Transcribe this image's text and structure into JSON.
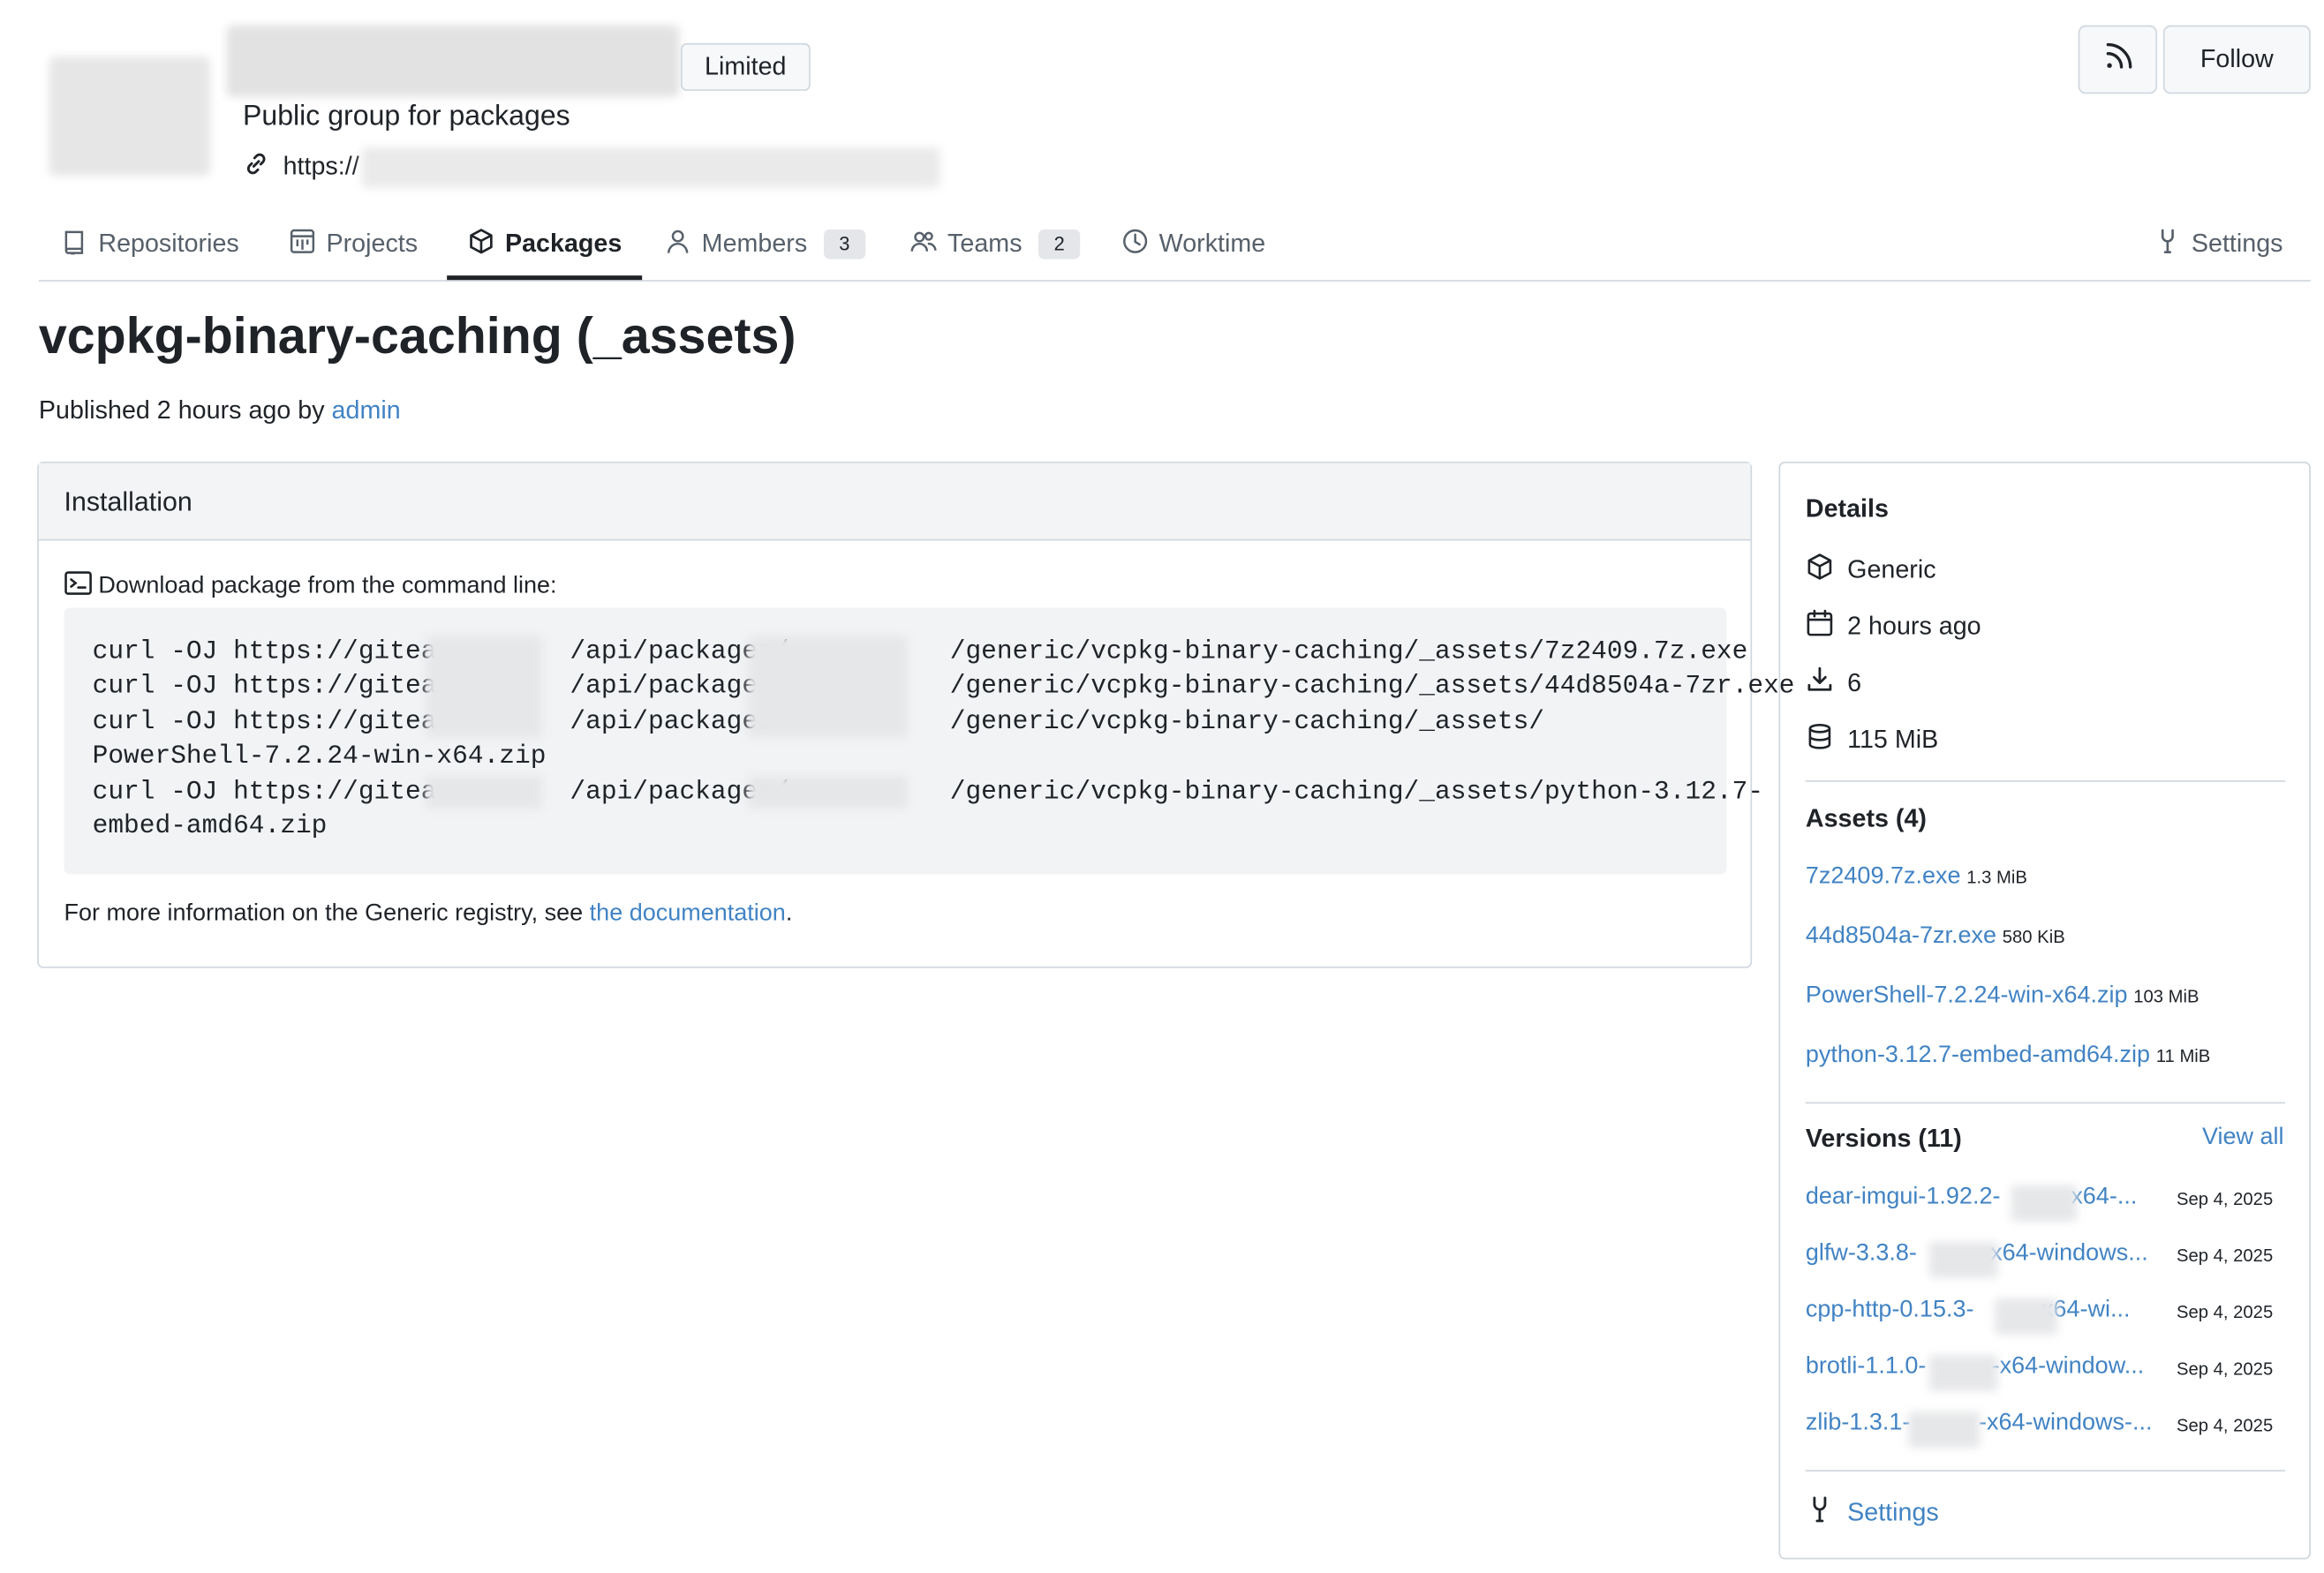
{
  "org": {
    "badge": "Limited",
    "description": "Public group for packages",
    "url_prefix": "https://",
    "follow_label": "Follow"
  },
  "tabs": [
    {
      "label": "Repositories"
    },
    {
      "label": "Projects"
    },
    {
      "label": "Packages"
    },
    {
      "label": "Members",
      "count": "3"
    },
    {
      "label": "Teams",
      "count": "2"
    },
    {
      "label": "Worktime"
    }
  ],
  "settings_tab": "Settings",
  "package": {
    "title": "vcpkg-binary-caching (_assets)",
    "published_prefix": "Published 2 hours ago by ",
    "publisher": "admin"
  },
  "installation": {
    "heading": "Installation",
    "subtitle": "Download package from the command line:",
    "code_lines": [
      {
        "a": "curl -OJ https://gitea.",
        "b": "/api/packages/",
        "c": "/generic/vcpkg-binary-caching/_assets/7z2409.7z.exe"
      },
      {
        "a": "curl -OJ https://gitea.",
        "b": "/api/packages/",
        "c": "/generic/vcpkg-binary-caching/_assets/44d8504a-7zr.exe"
      },
      {
        "a": "curl -OJ https://gitea.",
        "b": "/api/packages/",
        "c": "/generic/vcpkg-binary-caching/_assets/"
      },
      {
        "a": "PowerShell-7.2.24-win-x64.zip"
      },
      {
        "a": "curl -OJ https://gitea.",
        "b": "/api/packages/",
        "c": "/generic/vcpkg-binary-caching/_assets/python-3.12.7-"
      },
      {
        "a": "embed-amd64.zip"
      }
    ],
    "footer_prefix": "For more information on the Generic registry, see ",
    "footer_link": "the documentation",
    "footer_suffix": "."
  },
  "details": {
    "heading": "Details",
    "type": "Generic",
    "time": "2 hours ago",
    "downloads": "6",
    "size": "115 MiB"
  },
  "assets": {
    "heading": "Assets (4)",
    "items": [
      {
        "name": "7z2409.7z.exe",
        "size": "1.3 MiB"
      },
      {
        "name": "44d8504a-7zr.exe",
        "size": "580 KiB"
      },
      {
        "name": "PowerShell-7.2.24-win-x64.zip",
        "size": "103 MiB"
      },
      {
        "name": "python-3.12.7-embed-amd64.zip",
        "size": "11 MiB"
      }
    ]
  },
  "versions": {
    "heading": "Versions (11)",
    "view_all": "View all",
    "items": [
      {
        "name": "dear-imgui-1.92.2-",
        "tail": "-x64-...",
        "date": "Sep 4, 2025"
      },
      {
        "name": "glfw-3.3.8-",
        "tail": "-x64-windows...",
        "date": "Sep 4, 2025"
      },
      {
        "name": "cpp-http-0.15.3-",
        "tail": "-x64-wi...",
        "date": "Sep 4, 2025"
      },
      {
        "name": "brotli-1.1.0-",
        "tail": "-x64-window...",
        "date": "Sep 4, 2025"
      },
      {
        "name": "zlib-1.3.1-",
        "tail": "-x64-windows-...",
        "date": "Sep 4, 2025"
      }
    ]
  },
  "sidebar_settings": "Settings"
}
